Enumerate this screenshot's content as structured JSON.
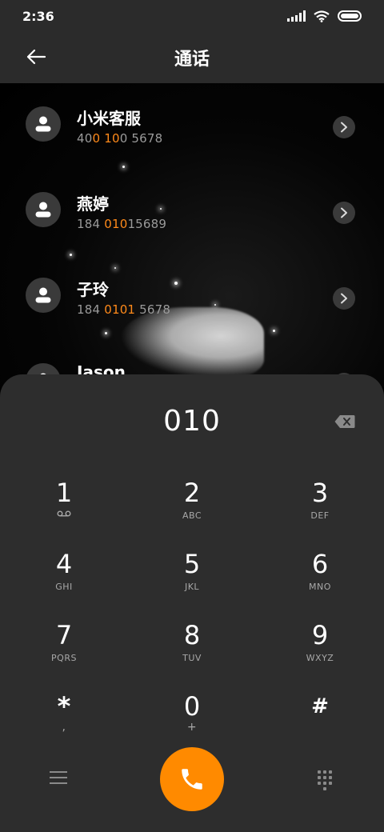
{
  "status": {
    "time": "2:36"
  },
  "appbar": {
    "title": "通话"
  },
  "contacts": [
    {
      "name": "小米客服",
      "number_parts": [
        "40",
        "0 10",
        "0 5678"
      ]
    },
    {
      "name": "燕婷",
      "number_parts": [
        "184 ",
        "010",
        "15689"
      ]
    },
    {
      "name": "子玲",
      "number_parts": [
        "184 ",
        "0101",
        " 5678"
      ]
    },
    {
      "name": "Jason"
    }
  ],
  "dialpad": {
    "input": "010",
    "keys": [
      {
        "digit": "1",
        "letters": ""
      },
      {
        "digit": "2",
        "letters": "ABC"
      },
      {
        "digit": "3",
        "letters": "DEF"
      },
      {
        "digit": "4",
        "letters": "GHI"
      },
      {
        "digit": "5",
        "letters": "JKL"
      },
      {
        "digit": "6",
        "letters": "MNO"
      },
      {
        "digit": "7",
        "letters": "PQRS"
      },
      {
        "digit": "8",
        "letters": "TUV"
      },
      {
        "digit": "9",
        "letters": "WXYZ"
      },
      {
        "digit": "*",
        "letters": ","
      },
      {
        "digit": "0",
        "letters": "+"
      },
      {
        "digit": "#",
        "letters": ""
      }
    ]
  },
  "icons": {
    "back": "arrow-left-icon",
    "delete": "backspace-icon",
    "menu": "menu-icon",
    "call": "phone-icon",
    "keypad": "keypad-icon",
    "voicemail": "voicemail-icon"
  },
  "colors": {
    "accent": "#ff8a1a",
    "call_button": "#ff8a00"
  }
}
